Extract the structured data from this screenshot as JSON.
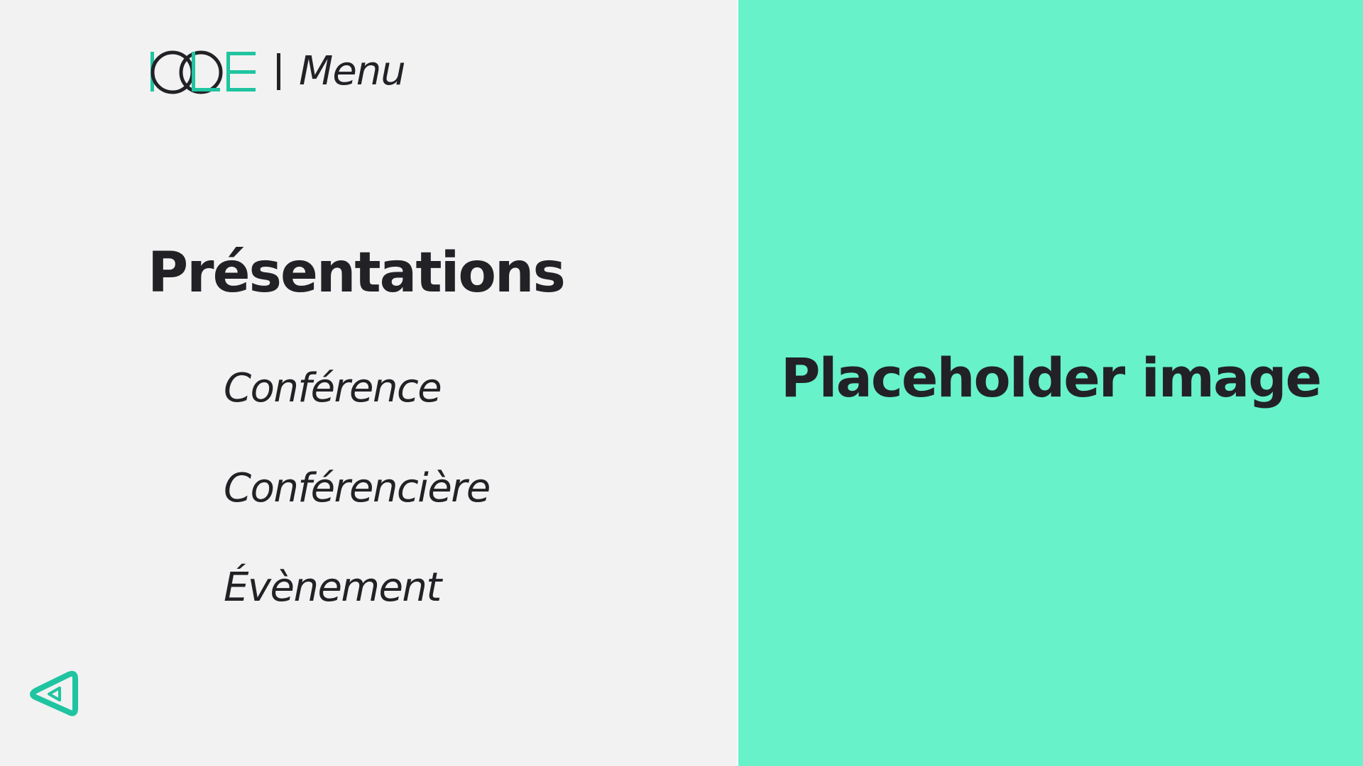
{
  "header": {
    "logo_text": "ICCE",
    "logo_name": "icce-logo",
    "title": "Menu"
  },
  "menu": {
    "heading": "Présentations",
    "items": [
      {
        "label": "Conférence"
      },
      {
        "label": "Conférencière"
      },
      {
        "label": "Évènement"
      }
    ]
  },
  "back_button": {
    "icon": "back-arrow-triangle-icon"
  },
  "placeholder": {
    "text": "Placeholder image"
  },
  "colors": {
    "accent": "#1fc4a0",
    "panel": "#67f2ca",
    "background": "#f2f2f2",
    "text": "#222226"
  }
}
